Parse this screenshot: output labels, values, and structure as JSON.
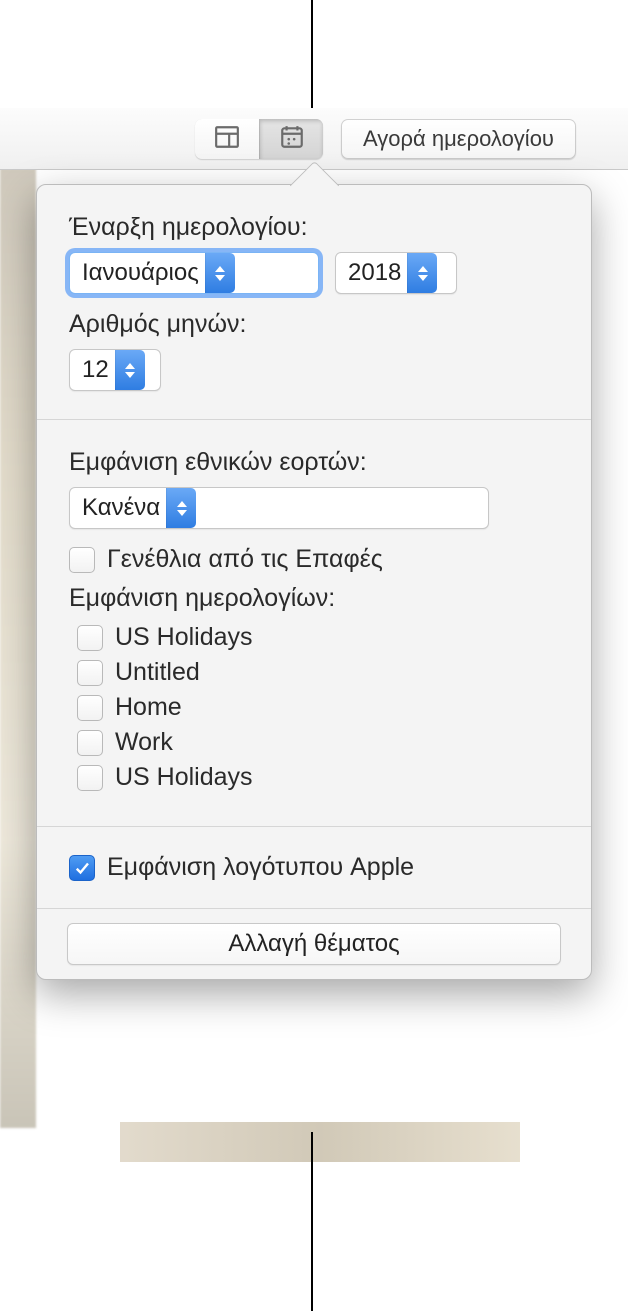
{
  "toolbar": {
    "layout_icon": "layout-grid-icon",
    "calendar_icon": "calendar-settings-icon",
    "buy_label": "Αγορά ημερολογίου"
  },
  "popover": {
    "start_label": "Έναρξη ημερολογίου:",
    "month_value": "Ιανουάριος",
    "year_value": "2018",
    "months_label": "Αριθμός μηνών:",
    "months_value": "12",
    "holidays_label": "Εμφάνιση εθνικών εορτών:",
    "holidays_value": "Κανένα",
    "birthdays_label": "Γενέθλια από τις Επαφές",
    "birthdays_checked": false,
    "calendars_label": "Εμφάνιση ημερολογίων:",
    "calendars": [
      {
        "label": "US Holidays",
        "checked": false
      },
      {
        "label": "Untitled",
        "checked": false
      },
      {
        "label": "Home",
        "checked": false
      },
      {
        "label": "Work",
        "checked": false
      },
      {
        "label": "US Holidays",
        "checked": false
      }
    ],
    "apple_logo_label": "Εμφάνιση λογότυπου Apple",
    "apple_logo_checked": true,
    "change_theme_label": "Αλλαγή θέματος"
  }
}
